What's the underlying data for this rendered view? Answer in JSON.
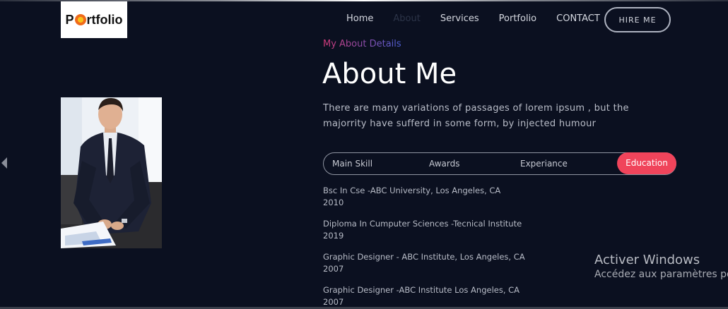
{
  "logo": {
    "prefix": "P",
    "suffix": "rtfolio"
  },
  "nav": {
    "items": [
      {
        "label": "Home",
        "active": false
      },
      {
        "label": "About",
        "active": true
      },
      {
        "label": "Services",
        "active": false
      },
      {
        "label": "Portfolio",
        "active": false
      },
      {
        "label": "CONTACT",
        "active": false
      }
    ],
    "hire_label": "HIRE ME"
  },
  "about": {
    "kicker": "My About Details",
    "title": "About Me",
    "description": "There are many variations of passages of lorem ipsum , but the majorrity have sufferd in some form, by injected humour"
  },
  "tabs": [
    {
      "label": "Main Skill",
      "active": false
    },
    {
      "label": "Awards",
      "active": false
    },
    {
      "label": "Experiance",
      "active": false
    },
    {
      "label": "Education",
      "active": true
    }
  ],
  "education": [
    {
      "title": "Bsc In Cse -ABC University, Los Angeles, CA",
      "year": "2010"
    },
    {
      "title": "Diploma In Cumputer Sciences -Tecnical Institute",
      "year": "2019"
    },
    {
      "title": "Graphic Designer - ABC Institute, Los Angeles, CA",
      "year": "2007"
    },
    {
      "title": "Graphic Designer -ABC Institute Los Angeles, CA",
      "year": "2007"
    }
  ],
  "windows_notice": {
    "title": "Activer Windows",
    "subtitle": "Accédez aux paramètres pou"
  },
  "colors": {
    "accent": "#f0445b",
    "background": "#0b1020"
  }
}
